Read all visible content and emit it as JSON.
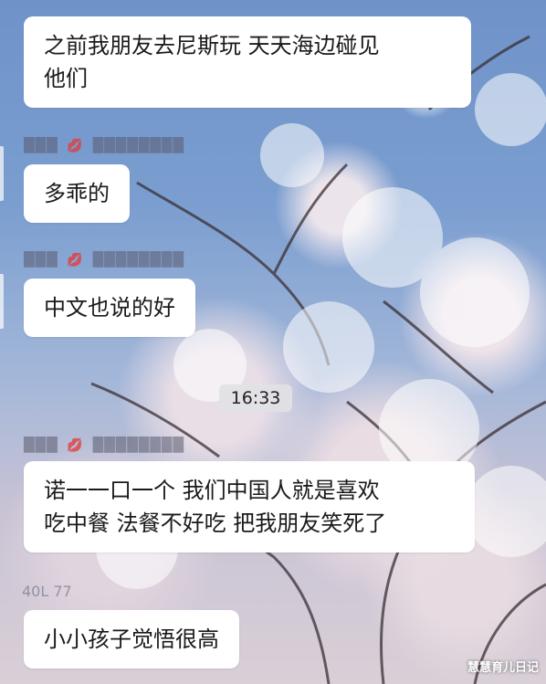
{
  "messages": [
    {
      "text": "之前我朋友去尼斯玩 天天海边碰见\n他们"
    },
    {
      "text": "多乖的"
    },
    {
      "text": "中文也说的好"
    },
    {
      "text": "诺一一口一个 我们中国人就是喜欢\n吃中餐 法餐不好吃 把我朋友笑死了"
    },
    {
      "text": "小小孩子觉悟很高"
    }
  ],
  "timestamp": "16:33",
  "bottom_label": "40L 77",
  "watermark": "慧慧育儿日记",
  "colors": {
    "bubble": "#ffffff",
    "sky": "#6f93c9",
    "lips": "#dc2846"
  }
}
